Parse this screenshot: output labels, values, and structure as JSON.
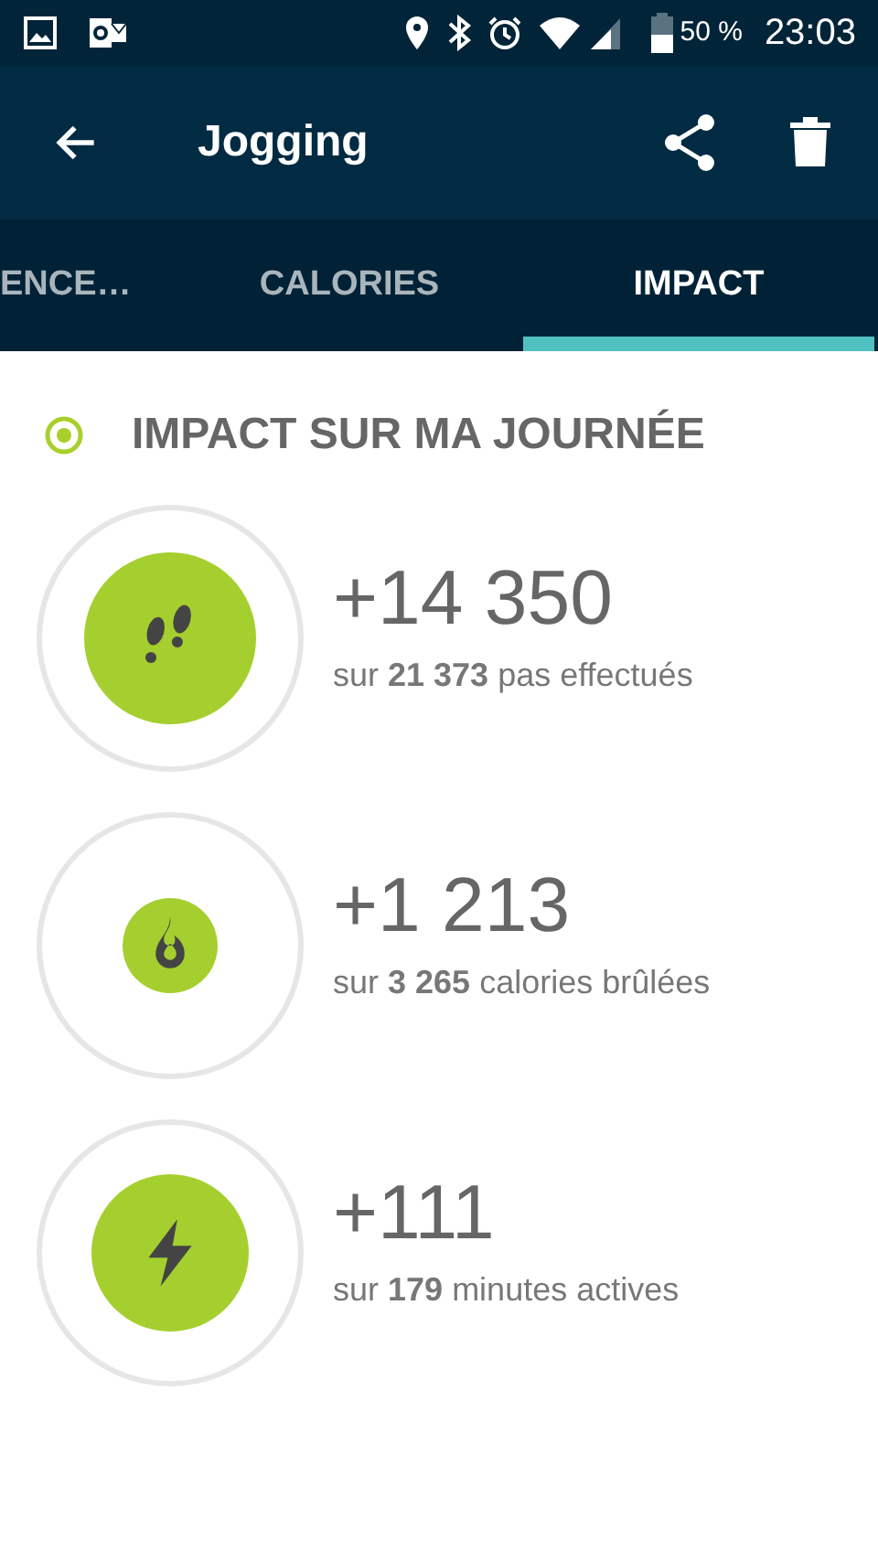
{
  "status_bar": {
    "battery": "50 %",
    "time": "23:03"
  },
  "app_bar": {
    "title": "Jogging"
  },
  "tabs": [
    {
      "label": "ENCE…",
      "selected": false
    },
    {
      "label": "CALORIES",
      "selected": false
    },
    {
      "label": "IMPACT",
      "selected": true
    }
  ],
  "section": {
    "title": "IMPACT SUR MA JOURNÉE"
  },
  "stats": [
    {
      "kind": "steps",
      "value": "+14 350",
      "detail": "sur **21 373** pas effectués"
    },
    {
      "kind": "calories",
      "value": "+1 213",
      "detail": "sur **3 265** calories brûlées"
    },
    {
      "kind": "minutes",
      "value": "+111",
      "detail": "sur **179** minutes actives"
    }
  ]
}
